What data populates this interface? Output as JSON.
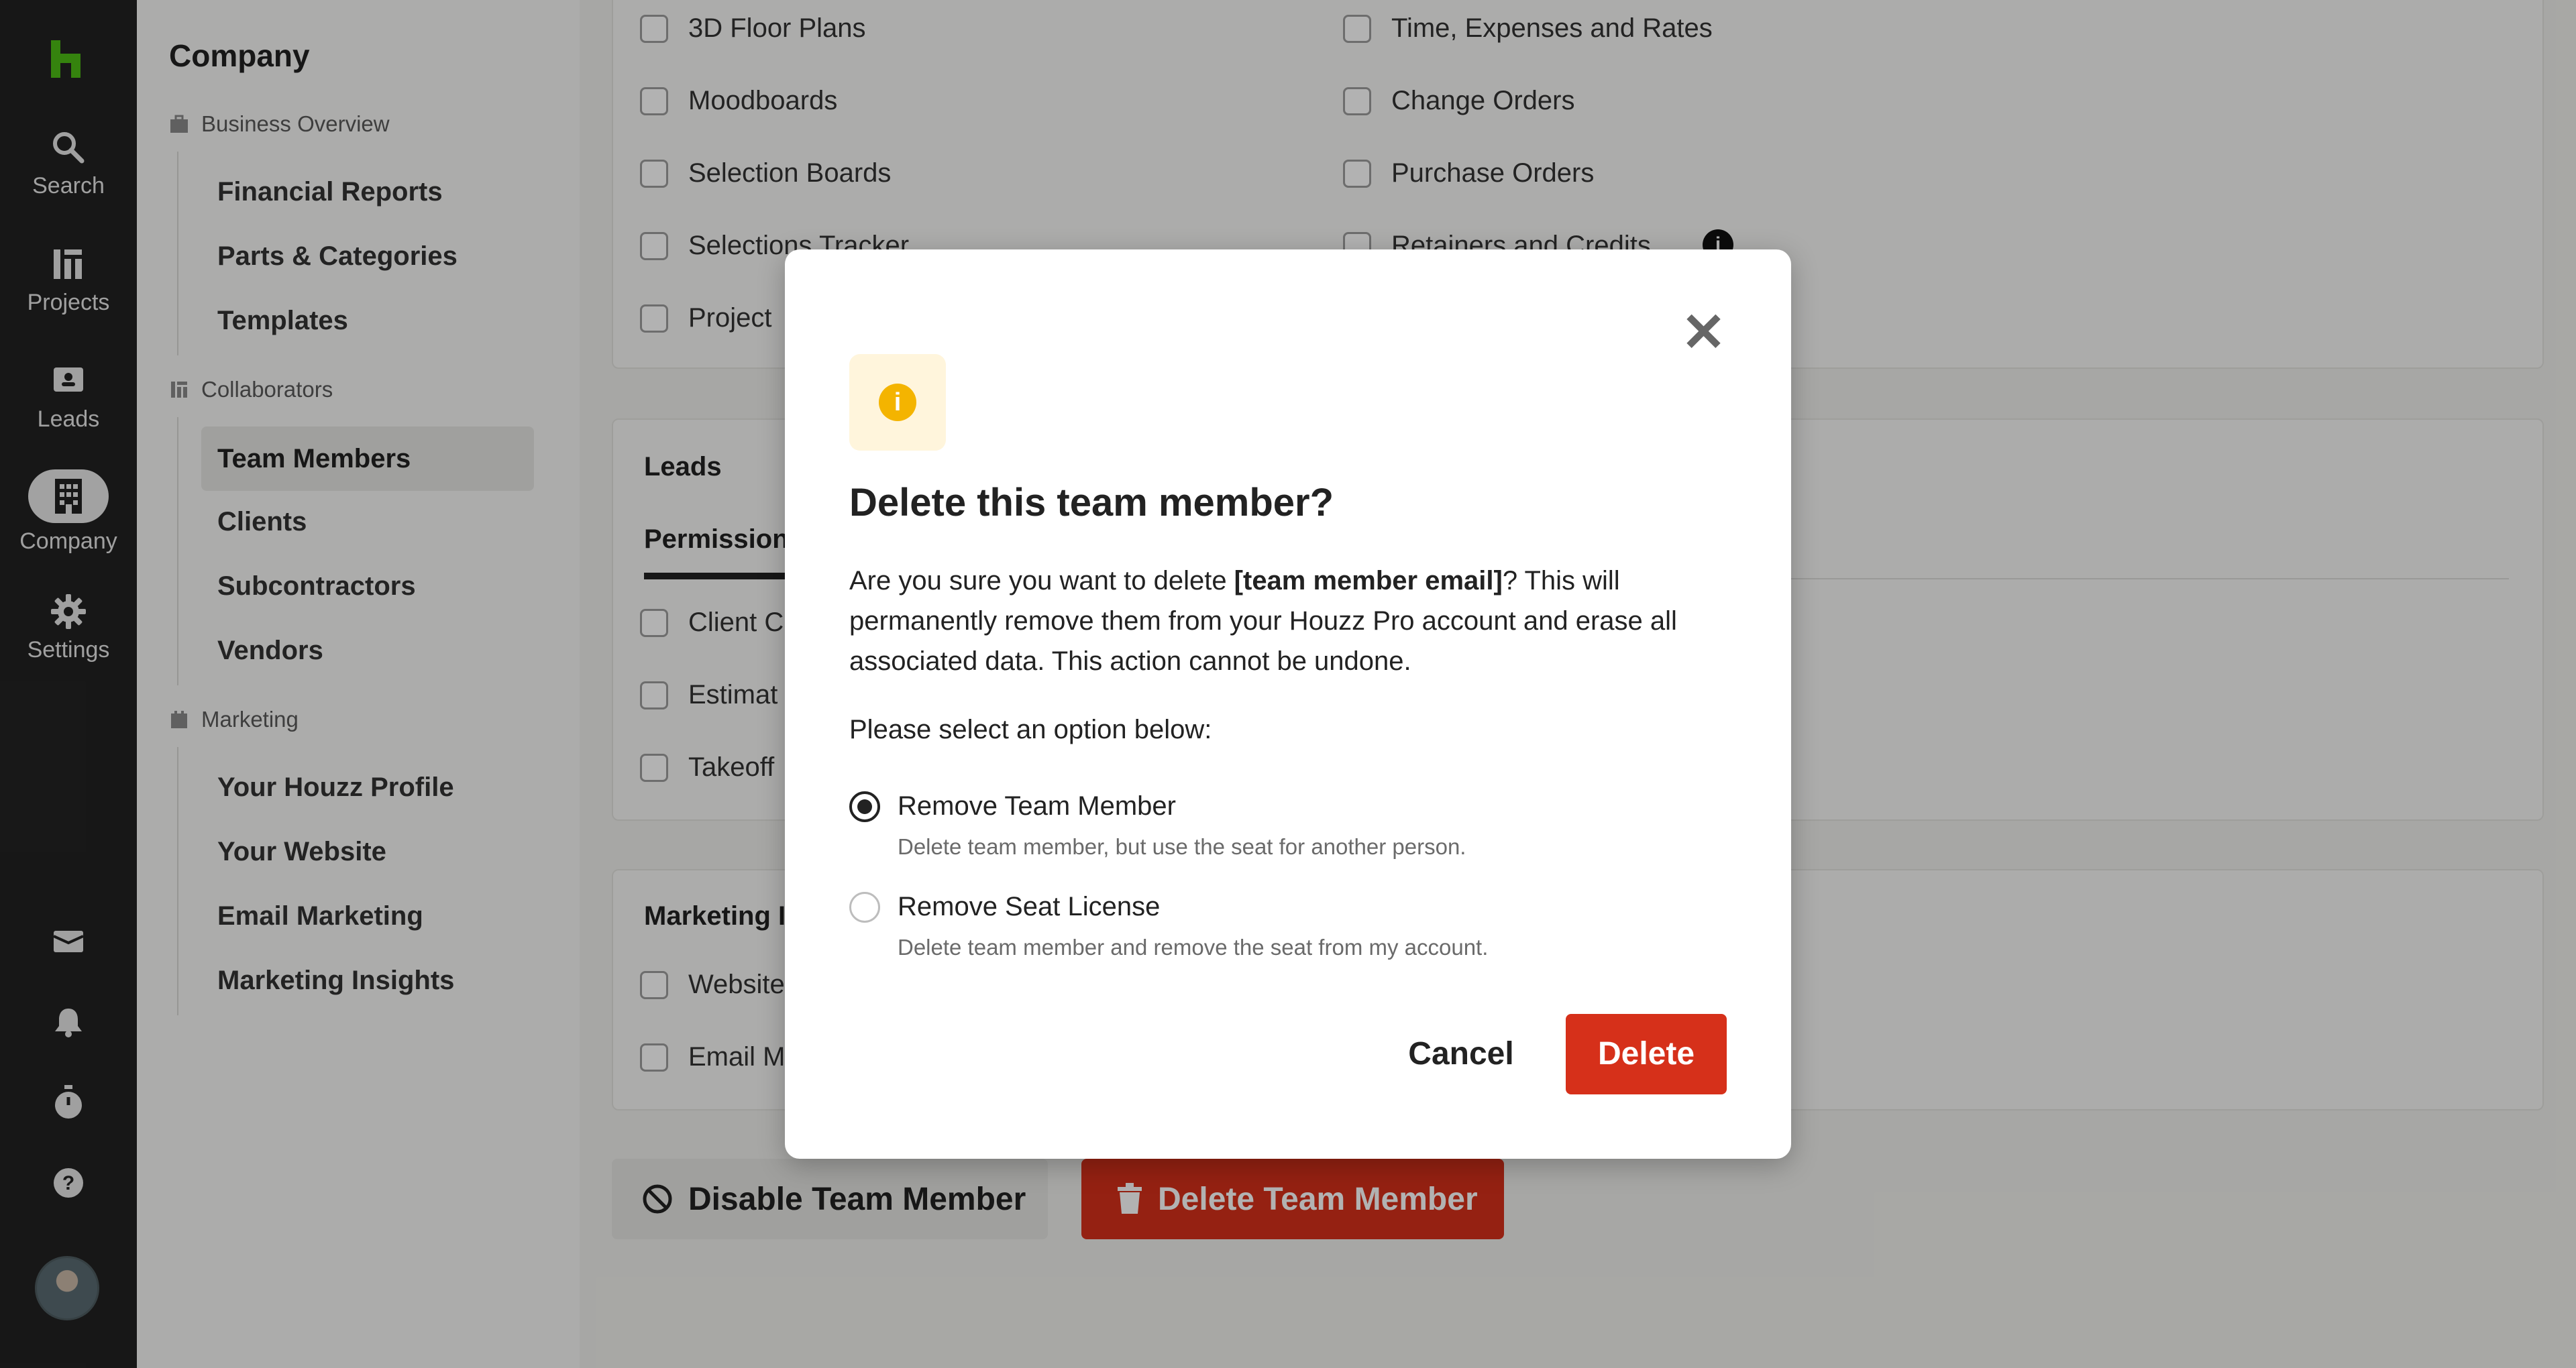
{
  "rail": {
    "items": [
      {
        "label": "Search"
      },
      {
        "label": "Projects"
      },
      {
        "label": "Leads"
      },
      {
        "label": "Company"
      },
      {
        "label": "Settings"
      }
    ],
    "brand_color": "#4dbc15"
  },
  "sidebar": {
    "title": "Company",
    "sections": [
      {
        "label": "Business Overview",
        "links": [
          "Financial Reports",
          "Parts & Categories",
          "Templates"
        ]
      },
      {
        "label": "Collaborators",
        "links": [
          "Team Members",
          "Clients",
          "Subcontractors",
          "Vendors"
        ]
      },
      {
        "label": "Marketing",
        "links": [
          "Your Houzz Profile",
          "Your Website",
          "Email Marketing",
          "Marketing Insights"
        ]
      }
    ]
  },
  "projects_card": {
    "left": [
      "3D Floor Plans",
      "Moodboards",
      "Selection Boards",
      "Selections Tracker",
      "Project"
    ],
    "right": [
      "Time, Expenses and Rates",
      "Change Orders",
      "Purchase Orders",
      "Retainers and Credits"
    ]
  },
  "leads_card": {
    "title": "Leads",
    "tab": "Permission",
    "items": [
      "Client C",
      "Estimat",
      "Takeoff"
    ]
  },
  "marketing_card": {
    "title": "Marketing I",
    "items": [
      "Website",
      "Email M"
    ]
  },
  "actions": {
    "disable": "Disable Team Member",
    "delete": "Delete Team Member"
  },
  "modal": {
    "title": "Delete this team member?",
    "body_pre": "Are you sure you want to delete ",
    "body_bold": "[team member email]",
    "body_post": "? This will permanently remove them from your Houzz Pro account and erase all associated data. This action cannot be undone.",
    "prompt": "Please select an option below:",
    "options": [
      {
        "label": "Remove Team Member",
        "desc": "Delete team member, but use the seat for another person.",
        "selected": true
      },
      {
        "label": "Remove Seat License",
        "desc": "Delete team member and remove the seat from my account.",
        "selected": false
      }
    ],
    "cancel": "Cancel",
    "delete": "Delete",
    "danger_color": "#d6301a",
    "warning_color": "#f4b400"
  }
}
